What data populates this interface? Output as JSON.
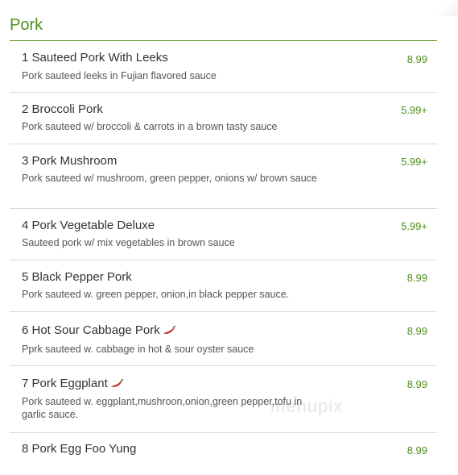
{
  "section": {
    "title": "Pork"
  },
  "items": [
    {
      "name": "1 Sauteed Pork With Leeks",
      "description": "Pork sauteed leeks in Fujian flavored sauce",
      "price": "8.99",
      "spicy": false
    },
    {
      "name": "2 Broccoli Pork",
      "description": "Pork sauteed w/ broccoli & carrots in a brown tasty sauce",
      "price": "5.99+",
      "spicy": false
    },
    {
      "name": "3 Pork Mushroom",
      "description": "Pork sauteed w/ mushroom, green pepper, onions w/ brown sauce",
      "price": "5.99+",
      "spicy": false
    },
    {
      "name": "4 Pork Vegetable Deluxe",
      "description": "Sauteed pork w/ mix vegetables in brown sauce",
      "price": "5.99+",
      "spicy": false
    },
    {
      "name": "5 Black Pepper Pork",
      "description": "Pork sauteed w. green pepper, onion,in black pepper sauce.",
      "price": "8.99",
      "spicy": false
    },
    {
      "name": "6 Hot Sour Cabbage Pork",
      "description": "Pprk sauteed w. cabbage in hot & sour oyster sauce",
      "price": "8.99",
      "spicy": true
    },
    {
      "name": "7 Pork Eggplant",
      "description": "Pork sauteed w. eggplant,mushroon,onion,green pepper,tofu in garlic sauce.",
      "price": "8.99",
      "spicy": true
    },
    {
      "name": "8 Pork Egg Foo Yung",
      "description": "",
      "price": "8.99",
      "spicy": false
    }
  ],
  "watermark": "menupix",
  "colors": {
    "accent": "#4f8f1d",
    "divider": "#d9d9d9",
    "pepper": "#c62828"
  },
  "icons": {
    "spicy": "chili-pepper-icon"
  }
}
